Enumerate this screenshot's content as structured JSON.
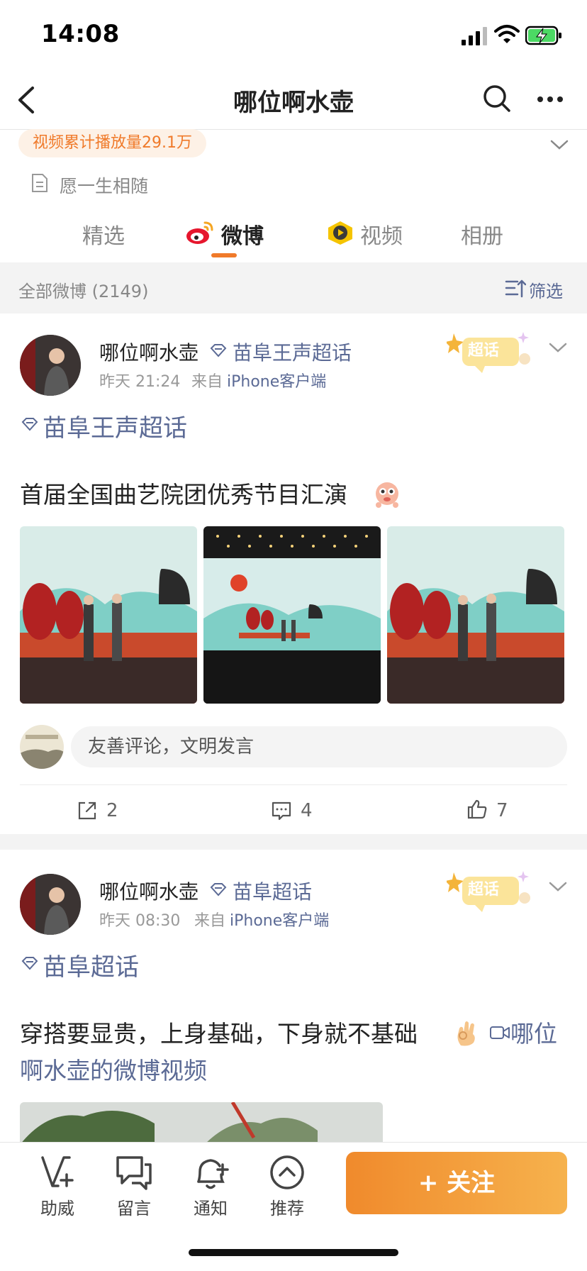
{
  "status_bar": {
    "time": "14:08"
  },
  "nav": {
    "title": "哪位啊水壶"
  },
  "profile": {
    "views_badge": "视频累计播放量29.1万",
    "motto": "愿一生相随"
  },
  "tabs": [
    {
      "label": "精选"
    },
    {
      "label": "微博"
    },
    {
      "label": "视频"
    },
    {
      "label": "相册"
    }
  ],
  "filter": {
    "all_label": "全部微博 (2149)",
    "filter_label": "筛选"
  },
  "posts": [
    {
      "username": "哪位啊水壶",
      "super_topic": "苗阜王声超话",
      "time": "昨天 21:24",
      "source_prefix": "来自",
      "source": "iPhone客户端",
      "sticker": "超话",
      "topic": "苗阜王声超话",
      "text": "首届全国曲艺院团优秀节目汇演",
      "comment_placeholder": "友善评论，文明发言",
      "reposts": "2",
      "comments": "4",
      "likes": "7"
    },
    {
      "username": "哪位啊水壶",
      "super_topic": "苗阜超话",
      "time": "昨天 08:30",
      "source_prefix": "来自",
      "source": "iPhone客户端",
      "sticker": "超话",
      "topic": "苗阜超话",
      "text": "穿搭要显贵，上身基础，下身就不基础",
      "video_link_line1": "哪位",
      "video_link_line2": "啊水壶的微博视频"
    }
  ],
  "bottom_bar": {
    "items": [
      {
        "label": "助威",
        "icon": "v-plus-icon"
      },
      {
        "label": "留言",
        "icon": "message-icon"
      },
      {
        "label": "通知",
        "icon": "bell-icon"
      },
      {
        "label": "推荐",
        "icon": "recommend-icon"
      }
    ],
    "follow_label": "+ 关注"
  },
  "colors": {
    "accent": "#f07a2a",
    "link": "#5b6a95"
  }
}
